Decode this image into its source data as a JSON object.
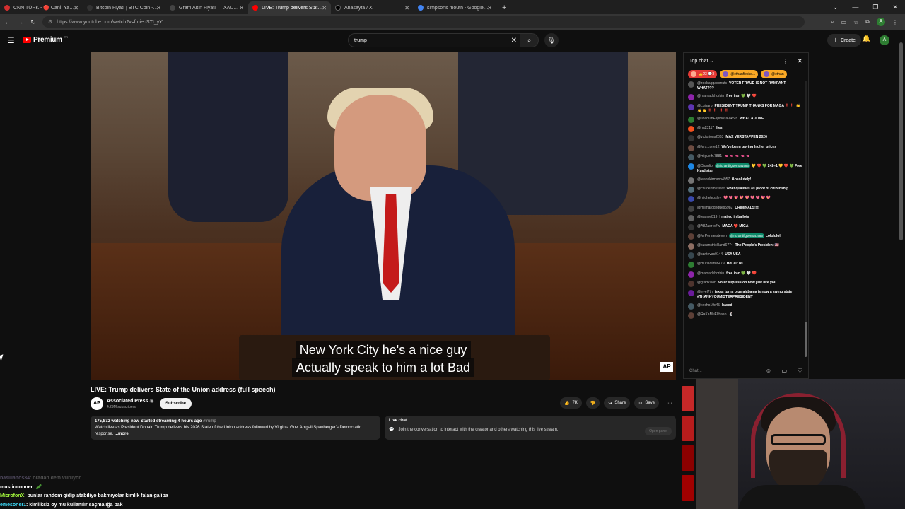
{
  "browser": {
    "tabs": [
      {
        "title": "CNN TÜRK - 🔴 Canlı Yayın",
        "color": "#d32f2f",
        "active": false
      },
      {
        "title": "Bitcoin Fiyatı | BTC Coin - Investing",
        "color": "#333333",
        "active": false
      },
      {
        "title": "Gram Altın Fiyatı — XAUTRYG",
        "color": "#444444",
        "active": false
      },
      {
        "title": "LIVE: Trump delivers State o",
        "color": "#ff0000",
        "active": true
      },
      {
        "title": "Anasayfa / X",
        "color": "#000000",
        "active": false
      },
      {
        "title": "simpsons mouth - Google Search",
        "color": "#4285f4",
        "active": false
      }
    ],
    "url": "https://www.youtube.com/watch?v=fmieoSTI_yY",
    "profile_initial": "A"
  },
  "yt": {
    "logo": "Premium",
    "search_query": "trump",
    "create_label": "Create",
    "avatar_initial": "A"
  },
  "video": {
    "captions": [
      "New York City he's a nice guy",
      "Actually speak to him a lot Bad"
    ],
    "watermark": "AP",
    "title": "LIVE: Trump delivers State of the Union address (full speech)",
    "channel": "Associated Press",
    "channel_avatar": "AP",
    "subscribers": "4.29M subscribers",
    "subscribe_label": "Subscribe",
    "likes": "7K",
    "share_label": "Share",
    "save_label": "Save",
    "desc_stats": "175,872 watching now  Started streaming 4 hours ago ",
    "desc_tag": "#trump",
    "desc_text": "Watch live as President Donald Trump delivers his 2026 State of the Union address followed by Virginia Gov. Abigail Spanberger's Democratic response.",
    "desc_more": "...more",
    "livechat_title": "Live chat",
    "livechat_text": "Join the conversation to interact with the creator and others watching this live stream.",
    "open_panel": "Open panel"
  },
  "chat": {
    "header": "Top chat",
    "pinned": [
      {
        "label": "👍23 💬3",
        "color": "#e53935"
      },
      {
        "label": "@ethanfiecke...",
        "color": "#f9a825"
      },
      {
        "label": "@ethan",
        "color": "#f9a825"
      }
    ],
    "messages": [
      {
        "name": "@zoebaggadonuts",
        "text": "VOTER FRAUD IS NOT RAMPANT WHAT???",
        "color": "#555555"
      },
      {
        "name": "@mamadkhorbin",
        "text": "free iran 💚 🤍 ❤️",
        "color": "#8e24aa"
      },
      {
        "name": "@Luisarb",
        "text": "PRESIDENT TRUMP THANKS FOR MAGA ‼️ ‼️ 👏 👏 👏 ‼️ ‼️ ‼️ ‼️",
        "color": "#5e35b1"
      },
      {
        "name": "@JoaquinEspinoza-ok5rc",
        "text": "WHAT A JOKE",
        "color": "#2e7d32"
      },
      {
        "name": "@na23117",
        "text": "lies",
        "color": "#f4511e"
      },
      {
        "name": "@victorious2863",
        "text": "MAX VERSTAPPEN 2026",
        "color": "#333333"
      },
      {
        "name": "@Mrs.Lone12",
        "text": "We've been paying higher prices",
        "color": "#6d4c41"
      },
      {
        "name": "@miguelh.7881",
        "text": "🫦 🫦 🫦 🫦 🫦",
        "color": "#455a64"
      },
      {
        "name": "@Diomlio",
        "text": "💛 ❤️ 💚 2+2=1 💛 ❤️ 💚 Free Kurdistan",
        "color": "#1e88e5",
        "mention": "@richardfiguerroa1985"
      },
      {
        "name": "@leannkirmann4957",
        "text": "Absolutely!",
        "color": "#757575"
      },
      {
        "name": "@chudenthusiast",
        "text": "what qualifies as proof of citizenship",
        "color": "#546e7a"
      },
      {
        "name": "@micheleosley",
        "text": "💖 💖 💖 💖 💖 💖 💖 💖 💖",
        "color": "#3949ab"
      },
      {
        "name": "@milmarodrigues5982",
        "text": "CRIMINALS!!!!",
        "color": "#424242"
      },
      {
        "name": "@jeanne819",
        "text": "I mailed in ballots",
        "color": "#616161"
      },
      {
        "name": "@A8Zaer-o7w",
        "text": "MAGA ❤️ MIGA",
        "color": "#333333"
      },
      {
        "name": "@MrPennersteven",
        "text": "Lololulol",
        "color": "#5d4037",
        "mention": "@richardfiguerroa1985"
      },
      {
        "name": "@susanstrickland6774",
        "text": "The People's President 🇺🇸",
        "color": "#8d6e63"
      },
      {
        "name": "@cantevas9144",
        "text": "USA USA",
        "color": "#37474f"
      },
      {
        "name": "@muriadiltsi8479",
        "text": "Hot air bs",
        "color": "#2e7d32"
      },
      {
        "name": "@mamadkhorbin",
        "text": "free iran 💚 🤍 ❤️",
        "color": "#8e24aa"
      },
      {
        "name": "@gradkison",
        "text": "Voter supression how just like you",
        "color": "#4e342e"
      },
      {
        "name": "@et-el7th",
        "text": "texas turns blue alabama is now a swing state #THANKYOUMISTERPRESIDENT",
        "color": "#6a1b9a"
      },
      {
        "name": "@xecho19x45",
        "text": "based",
        "color": "#455a64"
      },
      {
        "name": "@RaKaMuElthaan",
        "text": "🐇",
        "color": "#5d4037"
      }
    ],
    "input_placeholder": "Chat..."
  },
  "overlay_chat": [
    {
      "user": "basilianos34",
      "text": ": oradan dem vuruyor",
      "color": "#9e8fbf",
      "faded": true
    },
    {
      "user": "mustioconner",
      "text": ": 🥒",
      "color": "#ffffff",
      "faded": false
    },
    {
      "user": "MicrofonX",
      "text": ": bunlar random gidip atabiliyo bakmıyolar kimlik falan galiba",
      "color": "#a8ff3e",
      "faded": false
    },
    {
      "user": "emesoner1",
      "text": ": kimliksiz oy mu kullanılır saçmalığa bak",
      "color": "#3ee0ff",
      "faded": false
    }
  ]
}
